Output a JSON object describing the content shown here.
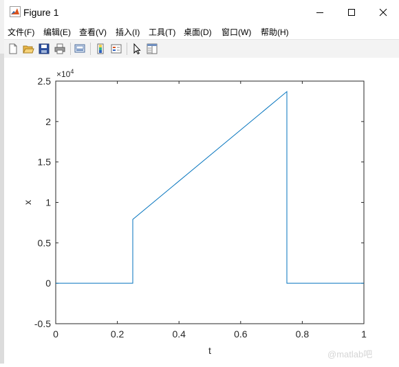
{
  "window": {
    "title": "Figure 1",
    "app_icon": "matlab-icon",
    "controls": [
      "minimize-icon",
      "maximize-icon",
      "close-icon"
    ]
  },
  "menu": {
    "items": [
      {
        "label": "文件(F)"
      },
      {
        "label": "编辑(E)"
      },
      {
        "label": "查看(V)"
      },
      {
        "label": "插入(I)"
      },
      {
        "label": "工具(T)"
      },
      {
        "label": "桌面(D)"
      },
      {
        "label": "窗口(W)"
      },
      {
        "label": "帮助(H)"
      }
    ]
  },
  "toolbar": {
    "icons": [
      "new-figure-icon",
      "open-file-icon",
      "save-icon",
      "print-icon",
      "link-plot-icon",
      "insert-colorbar-icon",
      "insert-legend-icon",
      "edit-plot-cursor-icon",
      "property-inspector-icon"
    ]
  },
  "chart_data": {
    "type": "line",
    "xlabel": "t",
    "ylabel": "x",
    "exponent_label": "×10",
    "exponent_power": "4",
    "xlim": [
      0,
      1
    ],
    "ylim": [
      -0.5,
      2.5
    ],
    "xticks": [
      "0",
      "0.2",
      "0.4",
      "0.6",
      "0.8",
      "1"
    ],
    "xtick_values": [
      0,
      0.2,
      0.4,
      0.6,
      0.8,
      1
    ],
    "yticks": [
      "-0.5",
      "0",
      "0.5",
      "1",
      "1.5",
      "2",
      "2.5"
    ],
    "ytick_values": [
      -0.5,
      0,
      0.5,
      1,
      1.5,
      2,
      2.5
    ],
    "grid": false,
    "line_color": "#0072bd",
    "series": [
      {
        "x": [
          0,
          0.25,
          0.25,
          0.75,
          0.75,
          1
        ],
        "y": [
          0,
          0,
          0.79,
          2.37,
          0,
          0
        ]
      }
    ]
  },
  "watermark": "@matlab吧"
}
